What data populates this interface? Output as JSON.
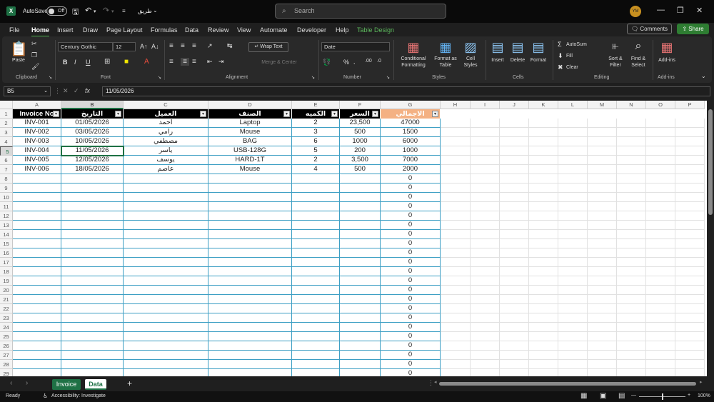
{
  "titlebar": {
    "autosave_label": "AutoSave",
    "autosave_state": "Off",
    "filename": "طريق",
    "search_placeholder": "Search",
    "avatar": "YM"
  },
  "menus": [
    "File",
    "Home",
    "Insert",
    "Draw",
    "Page Layout",
    "Formulas",
    "Data",
    "Review",
    "View",
    "Automate",
    "Developer",
    "Help",
    "Table Design"
  ],
  "buttons": {
    "comments": "Comments",
    "share": "Share"
  },
  "ribbon": {
    "clipboard": {
      "paste": "Paste",
      "label": "Clipboard"
    },
    "font": {
      "name": "Century Gothic",
      "size": "12",
      "label": "Font"
    },
    "alignment": {
      "wrap": "Wrap Text",
      "merge": "Merge & Center",
      "label": "Alignment"
    },
    "number": {
      "format": "Date",
      "label": "Number"
    },
    "styles": {
      "cond1": "Conditional",
      "cond2": "Formatting",
      "fmt1": "Format as",
      "fmt2": "Table",
      "cell1": "Cell",
      "cell2": "Styles",
      "label": "Styles"
    },
    "cells": {
      "insert": "Insert",
      "delete": "Delete",
      "format": "Format",
      "label": "Cells"
    },
    "editing": {
      "autosum": "AutoSum",
      "fill": "Fill",
      "clear": "Clear",
      "sort1": "Sort &",
      "sort2": "Filter",
      "find1": "Find &",
      "find2": "Select",
      "label": "Editing"
    },
    "addins": {
      "btn": "Add-ins",
      "label": "Add-ins"
    }
  },
  "formula": {
    "namebox": "B5",
    "value": "11/05/2026"
  },
  "columns": [
    "A",
    "B",
    "C",
    "D",
    "E",
    "F",
    "G",
    "H",
    "I",
    "J",
    "K",
    "L",
    "M",
    "N",
    "O",
    "P"
  ],
  "table": {
    "headers": [
      "Invoice No",
      "التاريخ",
      "العميل",
      "الصنف",
      "الكميه",
      "السعر",
      "الاجمالي"
    ],
    "rows": [
      [
        "INV-001",
        "01/05/2026",
        "احمد",
        "Laptop",
        "2",
        "23,500",
        "47000"
      ],
      [
        "INV-002",
        "03/05/2026",
        "رامي",
        "Mouse",
        "3",
        "500",
        "1500"
      ],
      [
        "INV-003",
        "10/05/2026",
        "مصطفي",
        "BAG",
        "6",
        "1000",
        "6000"
      ],
      [
        "INV-004",
        "11/05/2026",
        "ياسر",
        "USB-128G",
        "5",
        "200",
        "1000"
      ],
      [
        "INV-005",
        "12/05/2026",
        "يوسف",
        "HARD-1T",
        "2",
        "3,500",
        "7000"
      ],
      [
        "INV-006",
        "18/05/2026",
        "عاصم",
        "Mouse",
        "4",
        "500",
        "2000"
      ]
    ],
    "empty_total": "0"
  },
  "row_numbers": [
    "1",
    "2",
    "3",
    "4",
    "5",
    "6",
    "7",
    "8",
    "9",
    "10",
    "11",
    "12",
    "13",
    "14",
    "15",
    "16",
    "17",
    "18",
    "19",
    "20",
    "21",
    "22",
    "23",
    "24",
    "25",
    "26",
    "27",
    "28",
    "29"
  ],
  "sheets": [
    "Invoice",
    "Data"
  ],
  "status": {
    "ready": "Ready",
    "accessibility": "Accessibility: Investigate",
    "zoom": "100%"
  },
  "colors": {
    "accent": "#1e7145",
    "header_bg": "#000000",
    "total_bg": "#f4b183",
    "border": "#3d9fc4",
    "invoice_tab": "#1e7145"
  }
}
